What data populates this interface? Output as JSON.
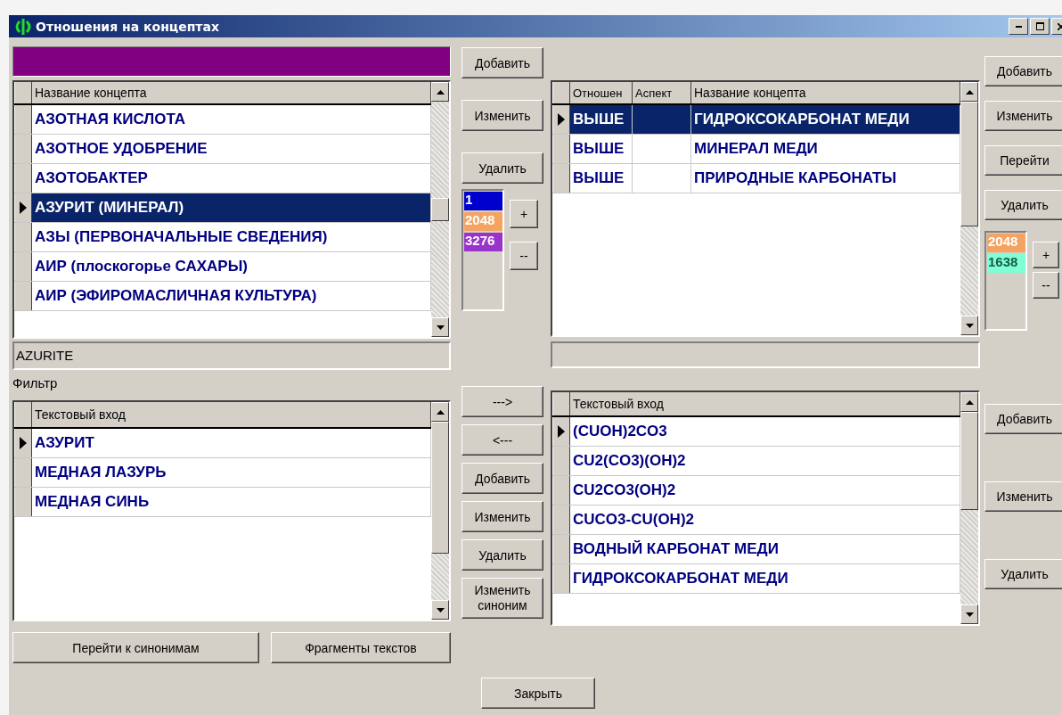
{
  "window": {
    "title": "Отношения на концептах"
  },
  "concepts_grid": {
    "columns": [
      "Название концепта"
    ],
    "rows": [
      {
        "cells": [
          "АЗОТНАЯ КИСЛОТА"
        ],
        "current": false,
        "selected": false
      },
      {
        "cells": [
          "АЗОТНОЕ УДОБРЕНИЕ"
        ],
        "current": false,
        "selected": false
      },
      {
        "cells": [
          "АЗОТОБАКТЕР"
        ],
        "current": false,
        "selected": false
      },
      {
        "cells": [
          "АЗУРИТ (МИНЕРАЛ)"
        ],
        "current": true,
        "selected": true
      },
      {
        "cells": [
          "АЗЫ (ПЕРВОНАЧАЛЬНЫЕ СВЕДЕНИЯ)"
        ],
        "current": false,
        "selected": false
      },
      {
        "cells": [
          "АИР (плоскогорье САХАРЫ)"
        ],
        "current": false,
        "selected": false
      },
      {
        "cells": [
          "АИР (ЭФИРОМАСЛИЧНАЯ КУЛЬТУРА)"
        ],
        "current": false,
        "selected": false
      }
    ]
  },
  "concept_buttons": [
    "Добавить",
    "Изменить",
    "Удалить"
  ],
  "concept_levels": {
    "items": [
      {
        "label": "1",
        "color": "#0000cc"
      },
      {
        "label": "2048",
        "color": "#f4a460"
      },
      {
        "label": "3276",
        "color": "#9933cc"
      }
    ],
    "buttons": [
      "+",
      "--"
    ]
  },
  "relations_grid": {
    "columns": [
      "Отношен",
      "Аспект",
      "Название концепта"
    ],
    "rows": [
      {
        "cells": [
          "ВЫШЕ",
          "",
          "ГИДРОКСОКАРБОНАТ МЕДИ"
        ],
        "current": true,
        "selected": true
      },
      {
        "cells": [
          "ВЫШЕ",
          "",
          "МИНЕРАЛ МЕДИ"
        ],
        "current": false,
        "selected": false
      },
      {
        "cells": [
          "ВЫШЕ",
          "",
          "ПРИРОДНЫЕ КАРБОНАТЫ"
        ],
        "current": false,
        "selected": false
      }
    ]
  },
  "relation_buttons": [
    "Добавить",
    "Изменить",
    "Перейти",
    "Удалить"
  ],
  "relation_levels": {
    "items": [
      {
        "label": "2048",
        "color": "#f4a460"
      },
      {
        "label": "1638",
        "color": "#7fffd4"
      }
    ],
    "buttons": [
      "+",
      "--"
    ]
  },
  "english_name": "AZURITE",
  "filter_label": "Фильтр",
  "entries_grid": {
    "columns": [
      "Текстовый вход"
    ],
    "rows": [
      {
        "cells": [
          "АЗУРИТ"
        ],
        "current": true,
        "selected": false
      },
      {
        "cells": [
          "МЕДНАЯ ЛАЗУРЬ"
        ],
        "current": false,
        "selected": false
      },
      {
        "cells": [
          "МЕДНАЯ СИНЬ"
        ],
        "current": false,
        "selected": false
      }
    ]
  },
  "entry_buttons": [
    "--->",
    "<---",
    "Добавить",
    "Изменить",
    "Удалить",
    "Изменить синоним"
  ],
  "synonyms_grid": {
    "columns": [
      "Текстовый вход"
    ],
    "rows": [
      {
        "cells": [
          "(CUOH)2CO3"
        ],
        "current": true,
        "selected": false
      },
      {
        "cells": [
          "CU2(CO3)(OH)2"
        ],
        "current": false,
        "selected": false
      },
      {
        "cells": [
          "CU2CO3(OH)2"
        ],
        "current": false,
        "selected": false
      },
      {
        "cells": [
          "CUCO3-CU(OH)2"
        ],
        "current": false,
        "selected": false
      },
      {
        "cells": [
          "ВОДНЫЙ КАРБОНАТ МЕДИ"
        ],
        "current": false,
        "selected": false
      },
      {
        "cells": [
          "ГИДРОКСОКАРБОНАТ МЕДИ"
        ],
        "current": false,
        "selected": false
      }
    ]
  },
  "synonym_buttons": [
    "Добавить",
    "Изменить",
    "Удалить"
  ],
  "bottom_buttons": [
    "Перейти к синонимам",
    "Фрагменты текстов"
  ],
  "close_button": "Закрыть"
}
